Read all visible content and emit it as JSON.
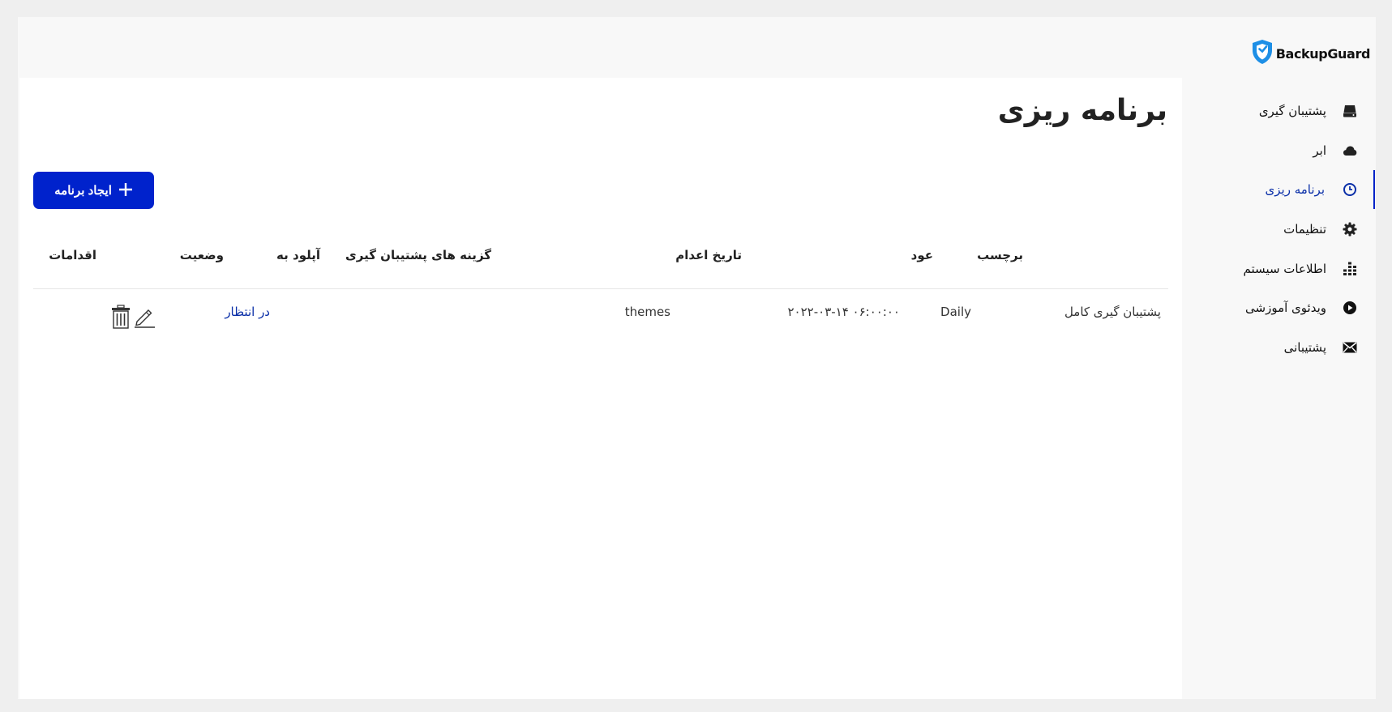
{
  "brand": {
    "name": "BackupGuard",
    "color": "#1e8fe6"
  },
  "sidebar": {
    "items": [
      {
        "label": "پشتیبان گیری",
        "icon": "hard-drive-icon",
        "active": false
      },
      {
        "label": "ابر",
        "icon": "cloud-icon",
        "active": false
      },
      {
        "label": "برنامه ریزی",
        "icon": "clock-icon",
        "active": true
      },
      {
        "label": "تنظیمات",
        "icon": "gear-icon",
        "active": false
      },
      {
        "label": "اطلاعات سیستم",
        "icon": "system-info-icon",
        "active": false
      },
      {
        "label": "ویدئوی آموزشی",
        "icon": "play-circle-icon",
        "active": false
      },
      {
        "label": "پشتیبانی",
        "icon": "envelope-icon",
        "active": false
      }
    ],
    "active_color": "#0022c8"
  },
  "main": {
    "title": "برنامه ریزی",
    "create_button": {
      "label": "ایجاد برنامه",
      "icon": "plus-icon",
      "color": "#0022cc"
    },
    "table": {
      "headers": {
        "label": "برچسب",
        "recurrence": "عود",
        "execution_date": "تاریخ اعدام",
        "backup_options": "گزینه های پشتیبان گیری",
        "upload_to": "آپلود به",
        "status": "وضعیت",
        "actions": "اقدامات"
      },
      "rows": [
        {
          "label": "پشتیبان گیری کامل",
          "recurrence": "Daily",
          "execution_date": "۲۰۲۲-۰۳-۱۴ ۰۶:۰۰:۰۰",
          "backup_options": "themes",
          "upload_to": "",
          "status": "در انتظار",
          "actions": [
            "edit-pencil-icon",
            "trash-icon"
          ]
        }
      ]
    }
  }
}
